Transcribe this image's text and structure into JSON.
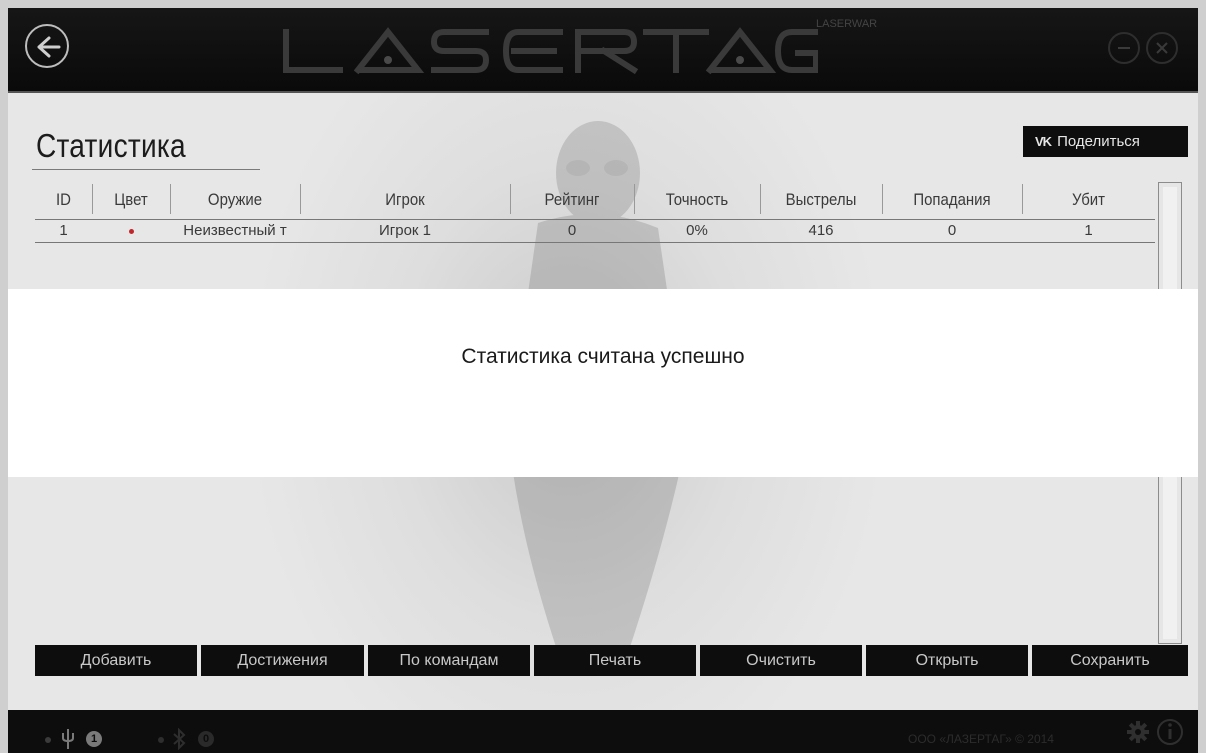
{
  "header": {
    "logo_text": "LASERTAG",
    "logo_sub": "LASERWAR"
  },
  "page": {
    "title": "Статистика",
    "share_icon": "VK",
    "share_label": "Поделиться"
  },
  "table": {
    "columns": [
      "ID",
      "Цвет",
      "Оружие",
      "Игрок",
      "Рейтинг",
      "Точность",
      "Выстрелы",
      "Попадания",
      "Убит"
    ],
    "rows": [
      {
        "id": "1",
        "color": "#c0262b",
        "weapon": "Неизвестный т",
        "player": "Игрок 1",
        "rating": "0",
        "accuracy": "0%",
        "shots": "416",
        "hits": "0",
        "killed": "1"
      }
    ]
  },
  "actions": [
    "Добавить",
    "Достижения",
    "По командам",
    "Печать",
    "Очистить",
    "Открыть",
    "Сохранить"
  ],
  "toast": {
    "message": "Статистика считана успешно"
  },
  "status": {
    "usb_count": "1",
    "bluetooth_count": "0",
    "copyright": "ООО «ЛАЗЕРТАГ» © 2014",
    "icons": [
      "usb-icon",
      "bluetooth-icon",
      "gear-icon",
      "info-icon"
    ]
  }
}
